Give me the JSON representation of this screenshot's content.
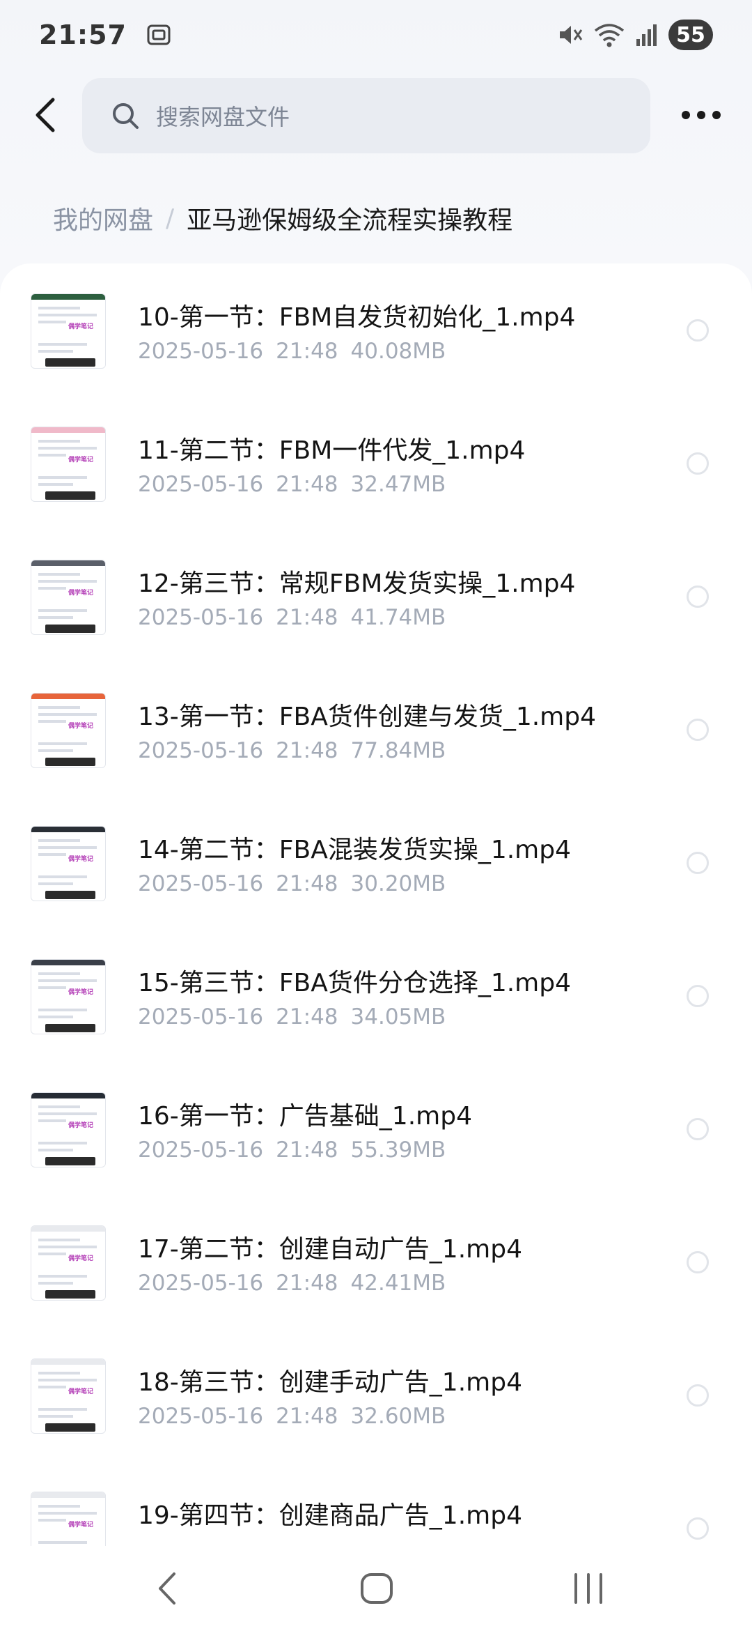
{
  "status_bar": {
    "time": "21:57",
    "battery": "55",
    "icons": [
      "screenshot-icon",
      "mute-icon",
      "wifi-icon",
      "signal-icon",
      "battery-icon"
    ]
  },
  "search": {
    "placeholder": "搜索网盘文件"
  },
  "breadcrumb": {
    "root": "我的网盘",
    "separator": "/",
    "current": "亚马逊保姆级全流程实操教程"
  },
  "files": [
    {
      "name": "10-第一节：FBM自发货初始化_1.mp4",
      "date": "2025-05-16",
      "time": "21:48",
      "size": "40.08MB",
      "thumb_bar": "#2d5f3f"
    },
    {
      "name": "11-第二节：FBM一件代发_1.mp4",
      "date": "2025-05-16",
      "time": "21:48",
      "size": "32.47MB",
      "thumb_bar": "#f0b9c9"
    },
    {
      "name": "12-第三节：常规FBM发货实操_1.mp4",
      "date": "2025-05-16",
      "time": "21:48",
      "size": "41.74MB",
      "thumb_bar": "#5a5f69"
    },
    {
      "name": "13-第一节：FBA货件创建与发货_1.mp4",
      "date": "2025-05-16",
      "time": "21:48",
      "size": "77.84MB",
      "thumb_bar": "#e7643a"
    },
    {
      "name": "14-第二节：FBA混装发货实操_1.mp4",
      "date": "2025-05-16",
      "time": "21:48",
      "size": "30.20MB",
      "thumb_bar": "#2a2f36"
    },
    {
      "name": "15-第三节：FBA货件分仓选择_1.mp4",
      "date": "2025-05-16",
      "time": "21:48",
      "size": "34.05MB",
      "thumb_bar": "#3a3f48"
    },
    {
      "name": "16-第一节：广告基础_1.mp4",
      "date": "2025-05-16",
      "time": "21:48",
      "size": "55.39MB",
      "thumb_bar": "#262c35"
    },
    {
      "name": "17-第二节：创建自动广告_1.mp4",
      "date": "2025-05-16",
      "time": "21:48",
      "size": "42.41MB",
      "thumb_bar": "#e8eaee"
    },
    {
      "name": "18-第三节：创建手动广告_1.mp4",
      "date": "2025-05-16",
      "time": "21:48",
      "size": "32.60MB",
      "thumb_bar": "#e8eaee"
    },
    {
      "name": "19-第四节：创建商品广告_1.mp4",
      "date": "",
      "time": "",
      "size": "",
      "thumb_bar": "#e8eaee"
    }
  ],
  "thumb_watermark": "偶学笔记",
  "colors": {
    "accent_watermark": "#b542b8",
    "radio_border": "#e1e4e9",
    "meta_text": "#a4abb7"
  }
}
